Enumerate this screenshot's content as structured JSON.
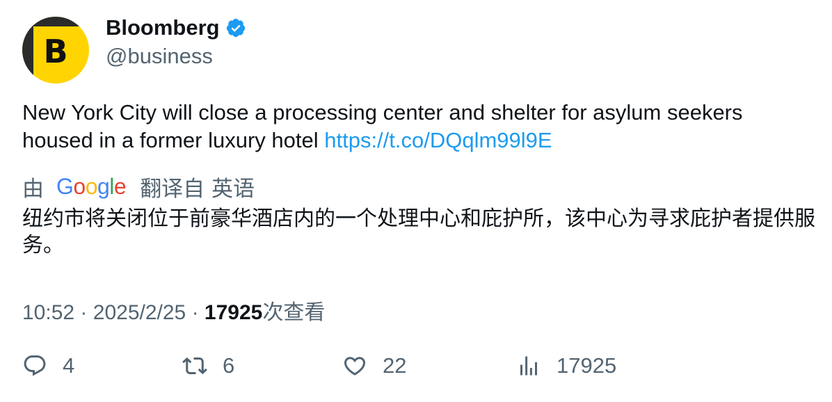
{
  "author": {
    "display_name": "Bloomberg",
    "handle": "@business",
    "avatar_letter": "B",
    "avatar_color": "#ffd400",
    "verified_color": "#1d9bf0"
  },
  "tweet": {
    "text": "New York City will close a processing center and shelter for asylum seekers housed in a former luxury hotel ",
    "link": "https://t.co/DQqlm99l9E"
  },
  "translation": {
    "prefix": "由",
    "provider": "Google",
    "suffix": "翻译自 英语",
    "text": "纽约市将关闭位于前豪华酒店内的一个处理中心和庇护所，该中心为寻求庇护者提供服务。"
  },
  "meta": {
    "time": "10:52",
    "separator": "·",
    "date": "2025/2/25",
    "views_count": "17925",
    "views_label": "次查看"
  },
  "actions": {
    "replies": "4",
    "retweets": "6",
    "likes": "22",
    "views": "17925"
  },
  "colors": {
    "link": "#1d9bf0",
    "secondary_text": "#536471",
    "primary_text": "#0f1419"
  }
}
